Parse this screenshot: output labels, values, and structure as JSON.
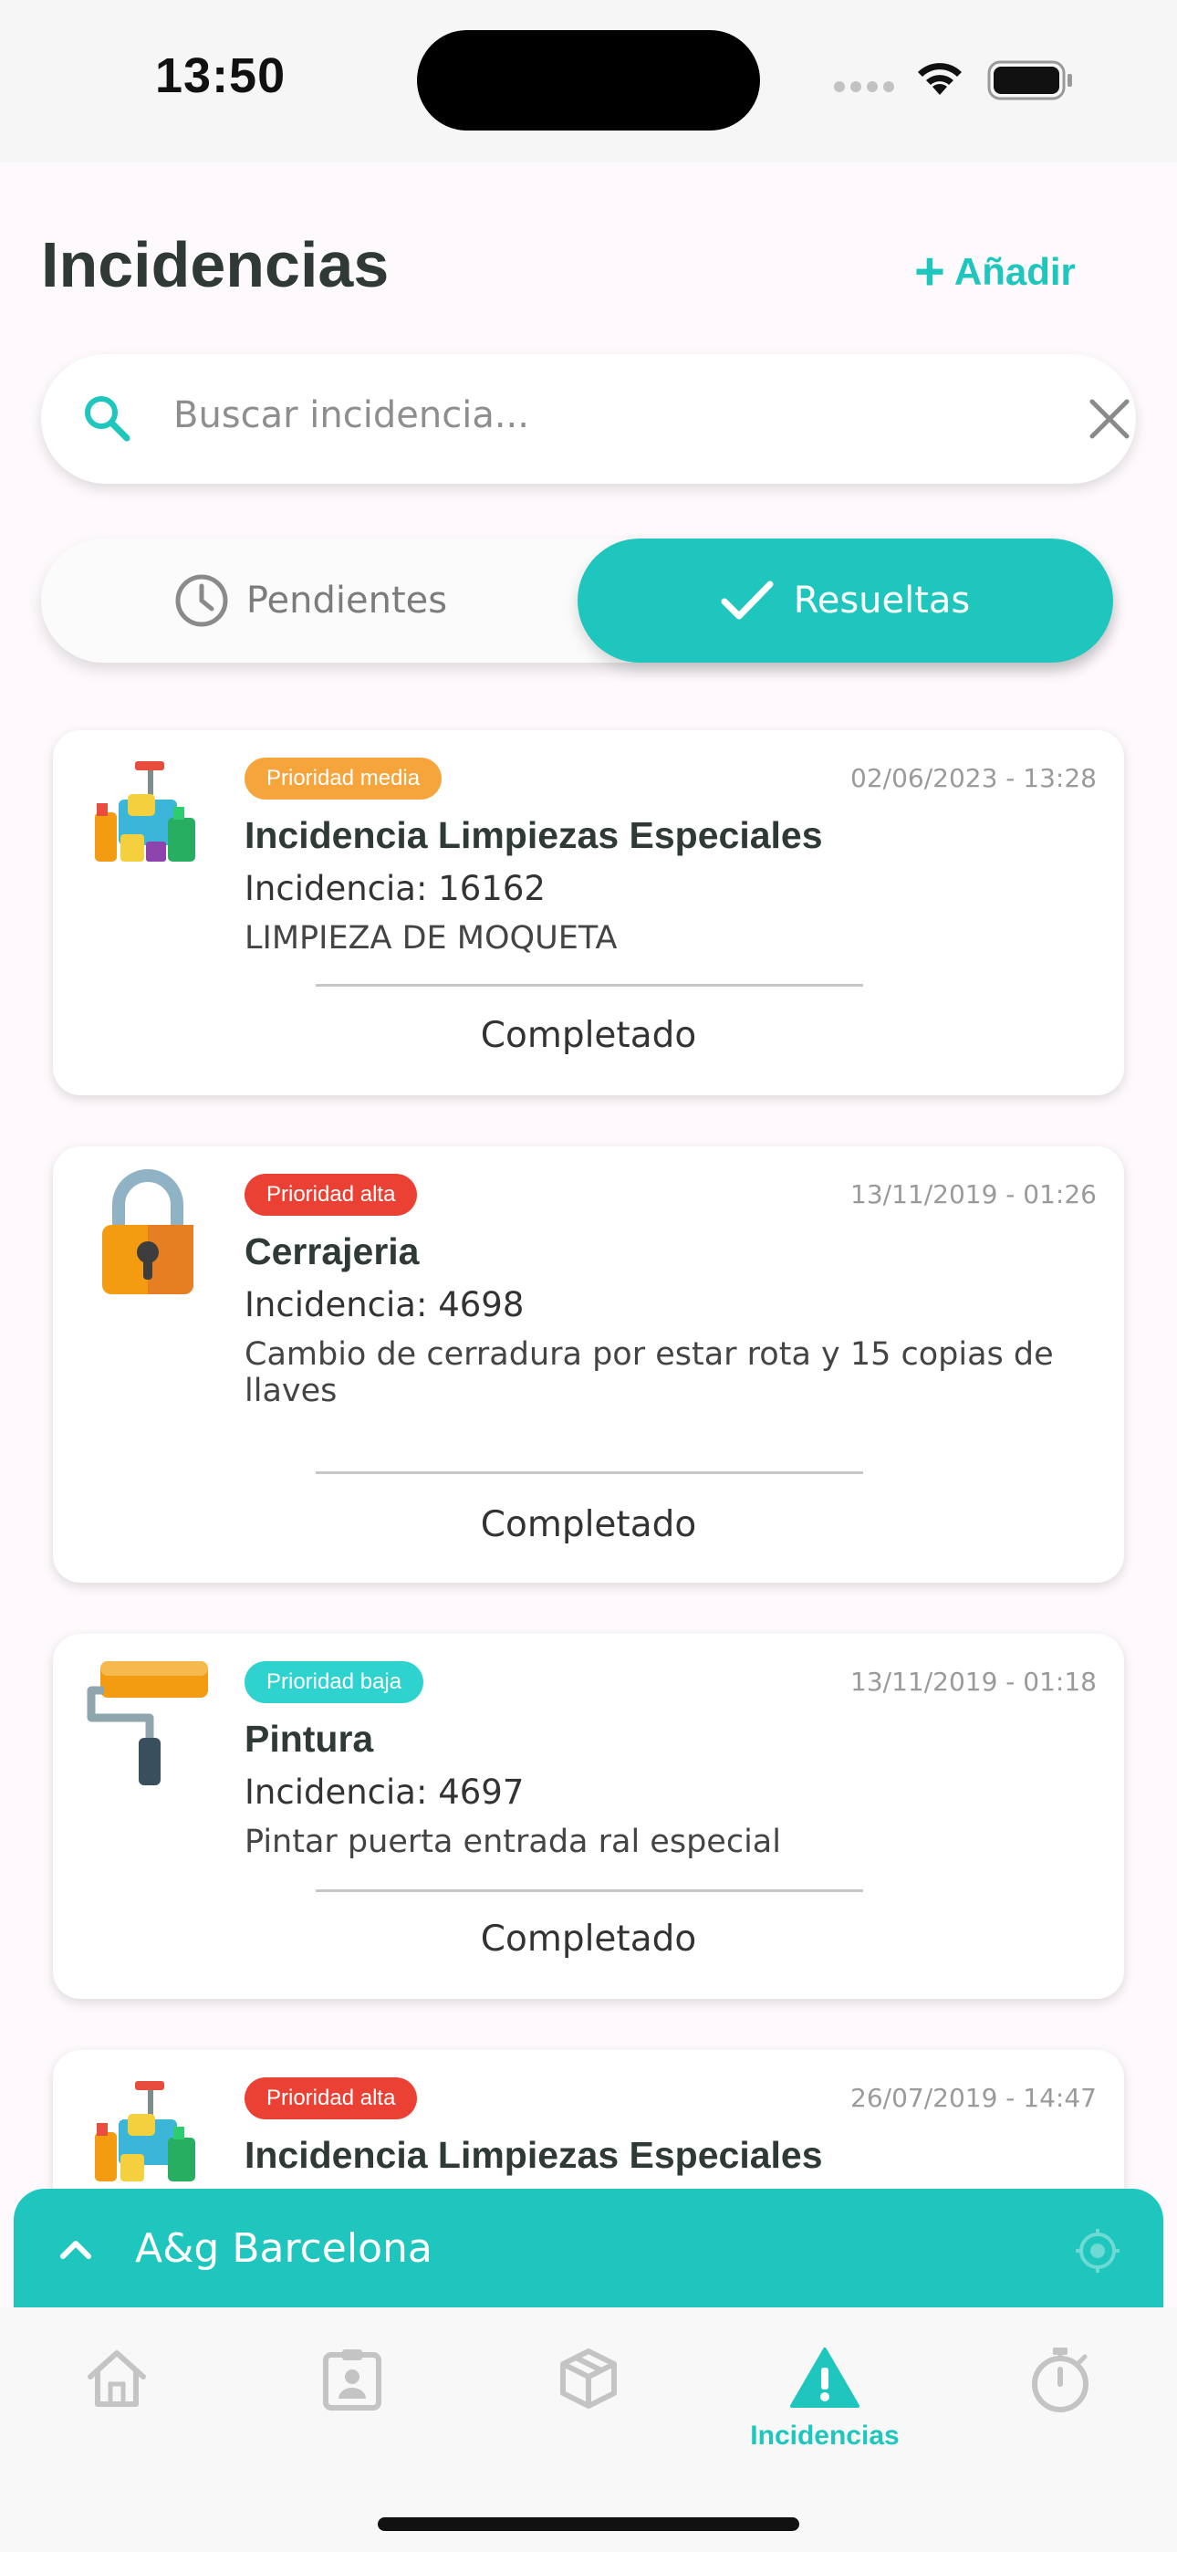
{
  "status_bar": {
    "time": "13:50"
  },
  "header": {
    "title": "Incidencias",
    "add_label": "Añadir"
  },
  "search": {
    "placeholder": "Buscar incidencia..."
  },
  "segments": {
    "pending": "Pendientes",
    "resolved": "Resueltas",
    "selected": "resolved"
  },
  "colors": {
    "accent": "#1fc6bd",
    "priority_media": "#f6a53c",
    "priority_alta": "#eb4034",
    "priority_baja": "#2ed3cf"
  },
  "incidents": [
    {
      "icon": "cleaning-supplies-icon",
      "priority": "Prioridad media",
      "date": "02/06/2023 - 13:28",
      "title": "Incidencia Limpiezas Especiales",
      "number": "Incidencia: 16162",
      "description": "LIMPIEZA DE MOQUETA",
      "status": "Completado"
    },
    {
      "icon": "padlock-icon",
      "priority": "Prioridad alta",
      "date": "13/11/2019 - 01:26",
      "title": "Cerrajeria",
      "number": "Incidencia: 4698",
      "description": "Cambio de cerradura por estar rota y 15 copias de llaves",
      "status": "Completado"
    },
    {
      "icon": "paint-roller-icon",
      "priority": "Prioridad baja",
      "date": "13/11/2019 - 01:18",
      "title": "Pintura",
      "number": "Incidencia: 4697",
      "description": "Pintar puerta entrada ral especial",
      "status": "Completado"
    },
    {
      "icon": "cleaning-supplies-icon",
      "priority": "Prioridad alta",
      "date": "26/07/2019 - 14:47",
      "title": "Incidencia Limpiezas Especiales"
    }
  ],
  "location": {
    "name": "A&g Barcelona"
  },
  "tabbar": {
    "active_label": "Incidencias"
  }
}
